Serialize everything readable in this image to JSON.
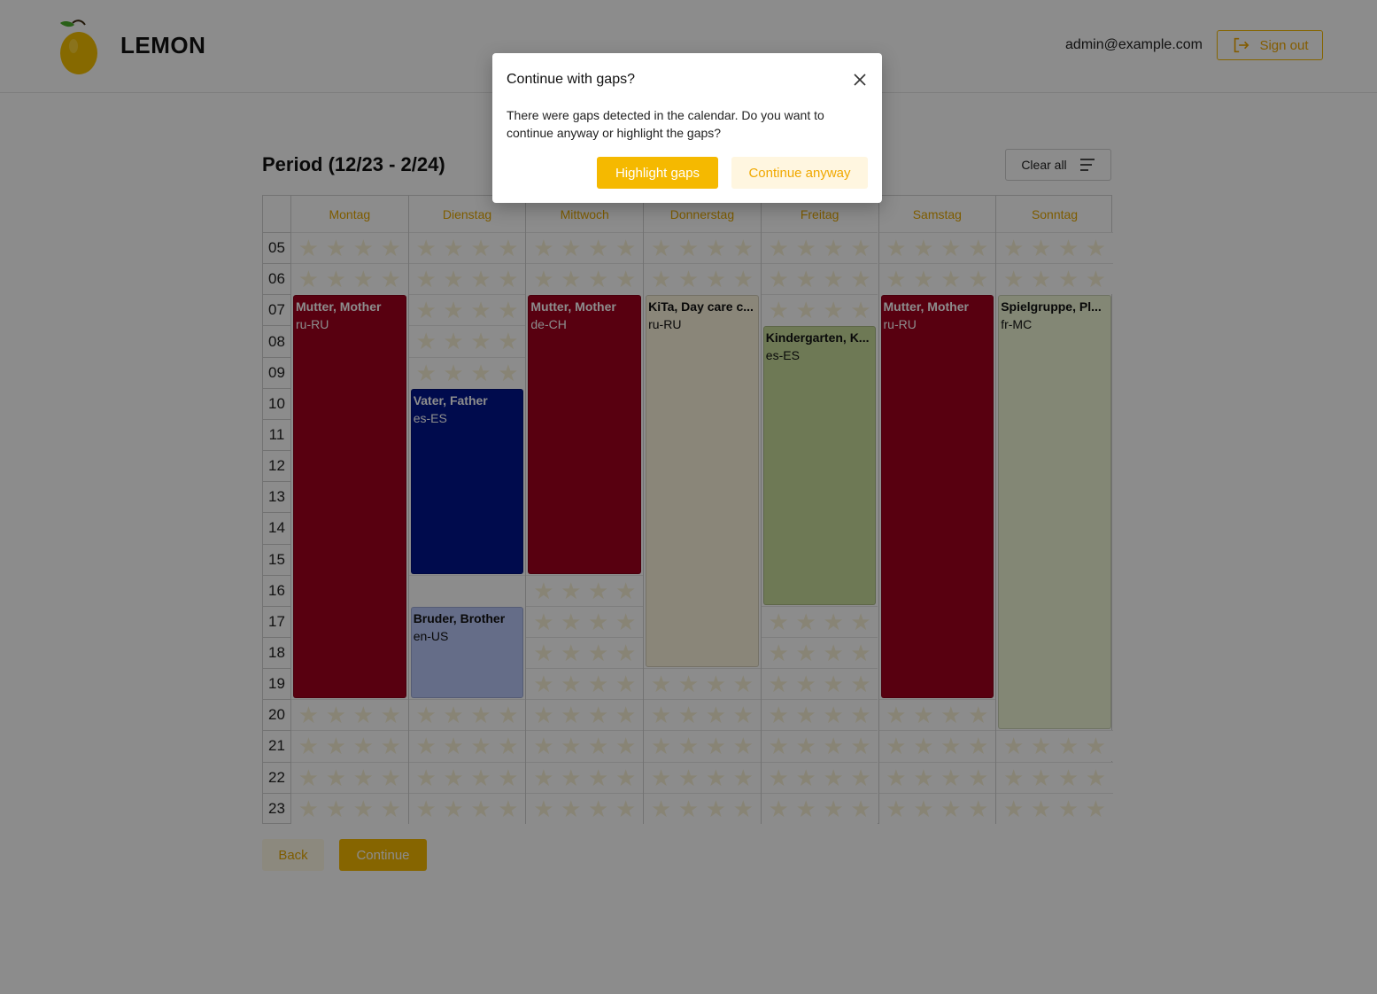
{
  "app": {
    "brand": "LEMON"
  },
  "header": {
    "user_email": "admin@example.com",
    "sign_out_label": "Sign out"
  },
  "period": {
    "title": "Period (12/23 - 2/24)",
    "clear_label": "Clear all"
  },
  "calendar": {
    "days": [
      "Montag",
      "Dienstag",
      "Mittwoch",
      "Donnerstag",
      "Freitag",
      "Samstag",
      "Sonntag"
    ],
    "hours": [
      "05",
      "06",
      "07",
      "08",
      "09",
      "10",
      "11",
      "12",
      "13",
      "14",
      "15",
      "16",
      "17",
      "18",
      "19",
      "20",
      "21",
      "22",
      "23"
    ],
    "events": [
      {
        "day": 0,
        "start": "07",
        "end": "20",
        "title": "Mutter, Mother",
        "lang": "ru-RU",
        "bg": "#a0001e",
        "fg": "#ffffff"
      },
      {
        "day": 1,
        "start": "10",
        "end": "16",
        "title": "Vater, Father",
        "lang": "es-ES",
        "bg": "#00148c",
        "fg": "#ffffff"
      },
      {
        "day": 1,
        "start": "17",
        "end": "20",
        "title": "Bruder, Brother",
        "lang": "en-US",
        "bg": "#b8c6f8",
        "fg": "#111111"
      },
      {
        "day": 2,
        "start": "07",
        "end": "16",
        "title": "Mutter, Mother",
        "lang": "de-CH",
        "bg": "#a0001e",
        "fg": "#ffffff"
      },
      {
        "day": 3,
        "start": "07",
        "end": "19",
        "title": "KiTa, Day care c...",
        "lang": "ru-RU",
        "bg": "#fbf4dd",
        "fg": "#111111"
      },
      {
        "day": 4,
        "start": "08",
        "end": "17",
        "title": "Kindergarten, K...",
        "lang": "es-ES",
        "bg": "#c8dc9c",
        "fg": "#111111"
      },
      {
        "day": 5,
        "start": "07",
        "end": "20",
        "title": "Mutter, Mother",
        "lang": "ru-RU",
        "bg": "#a0001e",
        "fg": "#ffffff"
      },
      {
        "day": 6,
        "start": "07",
        "end": "21",
        "title": "Spielgruppe, Pl...",
        "lang": "fr-MC",
        "bg": "#eef6d6",
        "fg": "#111111"
      }
    ],
    "blank": [
      {
        "day": 1,
        "hour": "16"
      }
    ]
  },
  "footer": {
    "back_label": "Back",
    "continue_label": "Continue"
  },
  "modal": {
    "title": "Continue with gaps?",
    "body": "There were gaps detected in the calendar. Do you want to continue anyway or highlight the gaps?",
    "highlight_label": "Highlight gaps",
    "continue_label": "Continue anyway"
  },
  "colors": {
    "accent": "#f5b900",
    "overlay": "rgba(0,0,0,0.45)"
  },
  "icons": {
    "sign_out": "sign-out-icon",
    "clear": "sort-lines-icon",
    "close": "close-icon",
    "empty_slot": "star-icon"
  }
}
